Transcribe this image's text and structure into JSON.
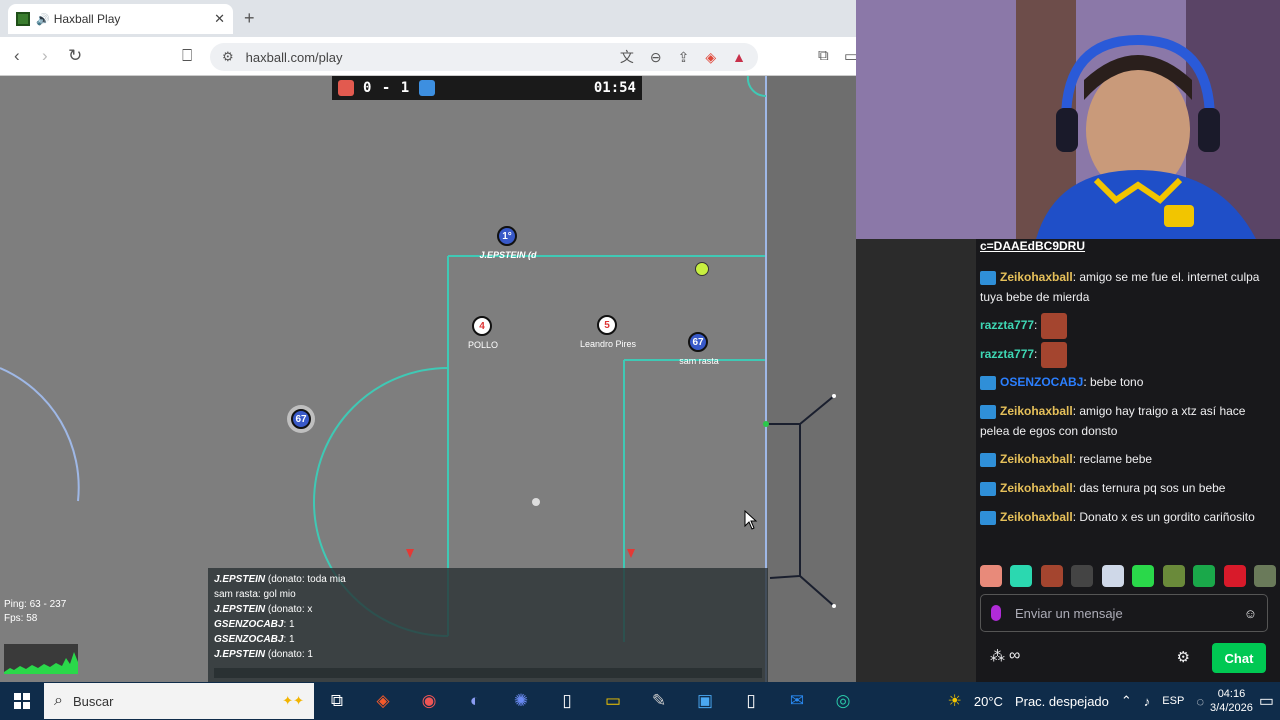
{
  "browser": {
    "tab_title": "Haxball Play",
    "url": "haxball.com/play"
  },
  "game": {
    "red_score": "0",
    "blue_score": "1",
    "separator": "-",
    "timer": "01:54",
    "players": [
      {
        "number": "1°",
        "name": "J.EPSTEIN (d",
        "team": "blue"
      },
      {
        "number": "4",
        "name": "POLLO",
        "team": "red"
      },
      {
        "number": "5",
        "name": "Leandro Pires",
        "team": "red"
      },
      {
        "number": "67",
        "name": "sam rasta",
        "team": "blue"
      },
      {
        "number": "67",
        "name": "",
        "team": "blue"
      }
    ],
    "chat": [
      {
        "who": "J.EPSTEIN",
        "text": " (donato: toda mia"
      },
      {
        "who": "",
        "text": "sam rasta: gol mio"
      },
      {
        "who": "J.EPSTEIN",
        "text": " (donato: x"
      },
      {
        "who": "GSENZOCABJ",
        "text": ": 1"
      },
      {
        "who": "GSENZOCABJ",
        "text": ": 1"
      },
      {
        "who": "J.EPSTEIN",
        "text": " (donato: 1"
      }
    ],
    "ping": "Ping: 63 - 237",
    "fps": "Fps: 58"
  },
  "twitch": {
    "top_link": "c=DAAEdBC9DRU",
    "messages": [
      {
        "user": "Zeikohaxball",
        "text": ": amigo se me fue el. internet culpa tuya bebe de mierda",
        "color": "zeiko"
      },
      {
        "user": "razzta777",
        "text": ":",
        "color": "razz"
      },
      {
        "user": "razzta777",
        "text": ":",
        "color": "razz"
      },
      {
        "user": "OSENZOCABJ",
        "text": ": bebe tono",
        "color": "osen"
      },
      {
        "user": "Zeikohaxball",
        "text": ": amigo hay traigo a xtz así hace pelea de egos con donsto",
        "color": "zeiko"
      },
      {
        "user": "Zeikohaxball",
        "text": ": reclame bebe",
        "color": "zeiko"
      },
      {
        "user": "Zeikohaxball",
        "text": ": das ternura pq sos un bebe",
        "color": "zeiko"
      },
      {
        "user": "Zeikohaxball",
        "text": ": Donato x es un gordito cariñosito",
        "color": "zeiko"
      }
    ],
    "input_placeholder": "Enviar un mensaje",
    "chat_button": "Chat"
  },
  "taskbar": {
    "search": "Buscar",
    "temp": "20°C",
    "weather": "Prac. despejado",
    "lang": "ESP",
    "time": "04:16",
    "date": "3/4/2026"
  }
}
